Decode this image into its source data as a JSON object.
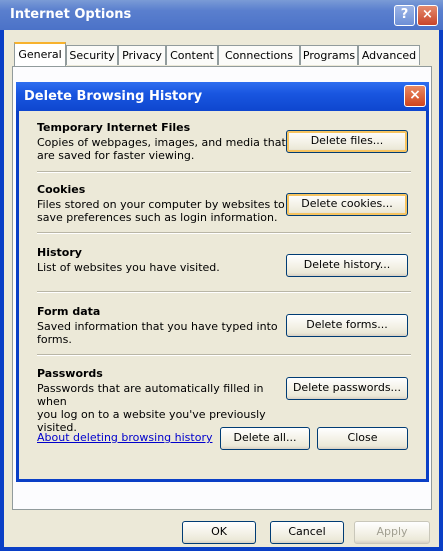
{
  "window": {
    "title": "Internet Options",
    "help_glyph": "?",
    "close_glyph": "×"
  },
  "tabs": [
    {
      "label": "General"
    },
    {
      "label": "Security"
    },
    {
      "label": "Privacy"
    },
    {
      "label": "Content"
    },
    {
      "label": "Connections"
    },
    {
      "label": "Programs"
    },
    {
      "label": "Advanced"
    }
  ],
  "dialog": {
    "title": "Delete Browsing History",
    "close_glyph": "×",
    "sections": [
      {
        "title": "Temporary Internet Files",
        "desc_lines": [
          "Copies of webpages, images, and media that",
          "are saved for faster viewing."
        ],
        "button": "Delete files..."
      },
      {
        "title": "Cookies",
        "desc_lines": [
          "Files stored on your computer by websites to",
          "save preferences such as login information."
        ],
        "button": "Delete cookies..."
      },
      {
        "title": "History",
        "desc_lines": [
          "List of websites you have visited."
        ],
        "button": "Delete history..."
      },
      {
        "title": "Form data",
        "desc_lines": [
          "Saved information that you have typed into",
          "forms."
        ],
        "button": "Delete forms..."
      },
      {
        "title": "Passwords",
        "desc_lines": [
          "Passwords that are automatically filled in when",
          "you log on to a website you've previously",
          "visited."
        ],
        "button": "Delete passwords..."
      }
    ],
    "about_link": "About deleting browsing history",
    "delete_all": "Delete all...",
    "close": "Close"
  },
  "footer": {
    "ok": "OK",
    "cancel": "Cancel",
    "apply": "Apply"
  }
}
